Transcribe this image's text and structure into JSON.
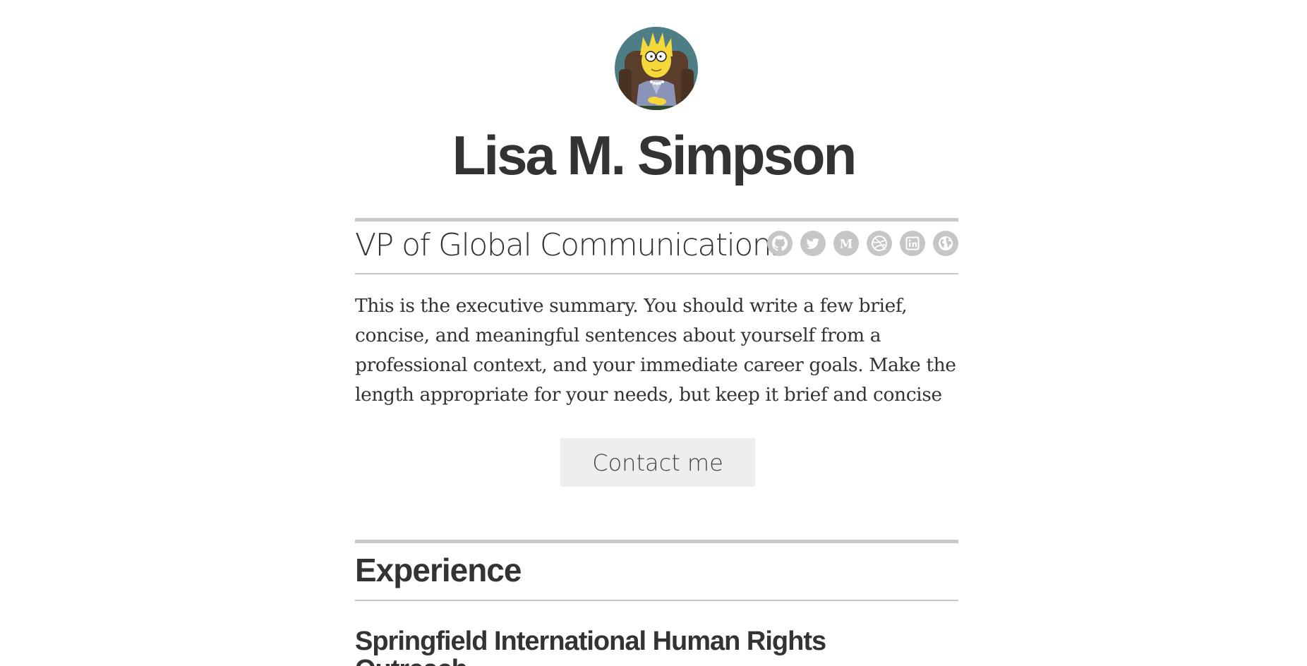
{
  "profile": {
    "name": "Lisa M. Simpson",
    "title": "VP of Global Communications",
    "avatar_alt": "Lisa Simpson avatar"
  },
  "social": [
    {
      "name": "github",
      "icon": "github-icon"
    },
    {
      "name": "twitter",
      "icon": "twitter-icon"
    },
    {
      "name": "medium",
      "icon": "medium-icon"
    },
    {
      "name": "dribbble",
      "icon": "dribbble-icon"
    },
    {
      "name": "linkedin",
      "icon": "linkedin-icon"
    },
    {
      "name": "website",
      "icon": "globe-icon"
    }
  ],
  "summary": "This is the executive summary. You should write a few brief, concise, and meaningful sentences about yourself from a professional context, and your immediate career goals. Make the length appropriate for your needs, but keep it brief and concise",
  "contact": {
    "label": "Contact me"
  },
  "experience": {
    "heading": "Experience",
    "items": [
      {
        "organization": "Springfield International Human Rights Outreach"
      }
    ]
  },
  "colors": {
    "text": "#333333",
    "rule": "#c8c8c8",
    "icon_bg": "#c6c6c6",
    "button_bg": "#eeeeee"
  }
}
